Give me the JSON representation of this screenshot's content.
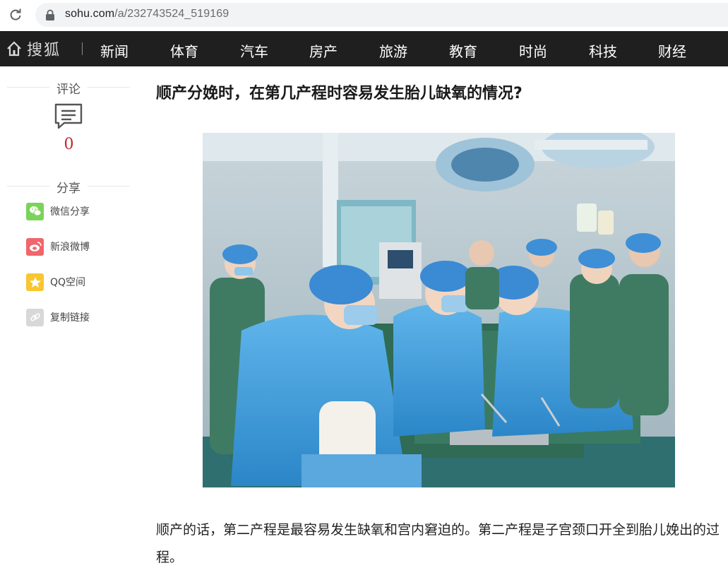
{
  "browser": {
    "url_host": "sohu.com",
    "url_path": "/a/232743524_519169"
  },
  "nav": {
    "logo": "搜狐",
    "items": [
      "新闻",
      "体育",
      "汽车",
      "房产",
      "旅游",
      "教育",
      "时尚",
      "科技",
      "财经"
    ]
  },
  "sidebar": {
    "comment_label": "评论",
    "comment_count": "0",
    "share_label": "分享",
    "share_items": [
      {
        "label": "微信分享",
        "icon": "wechat-icon",
        "color": "#7bd35a"
      },
      {
        "label": "新浪微博",
        "icon": "weibo-icon",
        "color": "#f0666b"
      },
      {
        "label": "QQ空间",
        "icon": "qzone-icon",
        "color": "#f8c630"
      },
      {
        "label": "复制链接",
        "icon": "link-icon",
        "color": "#d8d8d8"
      }
    ]
  },
  "article": {
    "title": "顺产分娩时，在第几产程时容易发生胎儿缺氧的情况?",
    "paragraph": "顺产的话，第二产程是最容易发生缺氧和宫内窘迫的。第二产程是子宫颈口开全到胎儿娩出的过程。"
  },
  "colors": {
    "nav_bg": "#1f1f1f",
    "accent_red": "#c1272d",
    "scrub_blue": "#3b9ad9",
    "scrub_green": "#2f6b55"
  }
}
